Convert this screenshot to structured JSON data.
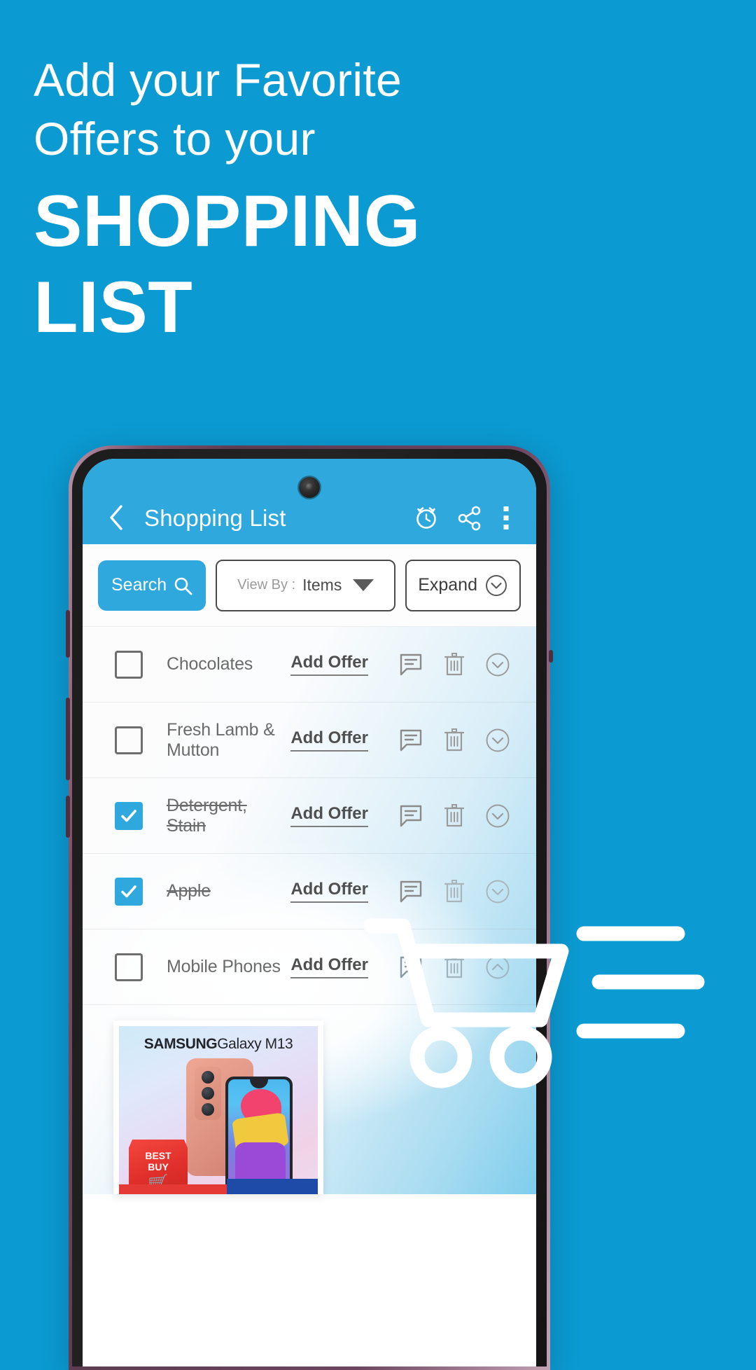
{
  "promo": {
    "headline_light": "Add your Favorite\nOffers to your",
    "headline_bold": "SHOPPING\nLIST",
    "background_color": "#0b9ad1",
    "accent_color": "#2fa8dd",
    "cart_graphic": "shopping-cart-icon"
  },
  "app": {
    "appbar": {
      "back_icon": "chevron-left-icon",
      "title": "Shopping List",
      "alarm_icon": "alarm-clock-icon",
      "share_icon": "share-icon",
      "overflow_icon": "more-vertical-icon"
    },
    "toolbar": {
      "search_label": "Search",
      "search_icon": "search-icon",
      "viewby_label": "View By :",
      "viewby_value": "Items",
      "viewby_caret": "caret-down-icon",
      "expand_label": "Expand",
      "expand_icon": "chevron-down-circle-icon"
    },
    "list": {
      "row_icons": {
        "note": "note-icon",
        "delete": "trash-icon",
        "expand": "chevron-down-circle-icon",
        "collapse": "chevron-up-circle-icon"
      },
      "offer_label": "Add Offer",
      "items": [
        {
          "name": "Chocolates",
          "checked": false,
          "offer": "Add Offer",
          "toggle": "chevron-down-circle-icon"
        },
        {
          "name": "Fresh Lamb & Mutton",
          "checked": false,
          "offer": "Add Offer",
          "toggle": "chevron-down-circle-icon"
        },
        {
          "name": "Detergent, Stain",
          "checked": true,
          "offer": "Add Offer",
          "toggle": "chevron-down-circle-icon"
        },
        {
          "name": "Apple",
          "checked": true,
          "offer": "Add Offer",
          "toggle": "chevron-down-circle-icon"
        },
        {
          "name": "Mobile Phones",
          "checked": false,
          "offer": "Add Offer",
          "toggle": "chevron-up-circle-icon"
        }
      ]
    },
    "offer_card": {
      "brand": "SAMSUNG",
      "model": "Galaxy M13",
      "badge_line1": "BEST",
      "badge_line2": "BUY",
      "badge_icon": "shopping-cart-icon"
    }
  }
}
